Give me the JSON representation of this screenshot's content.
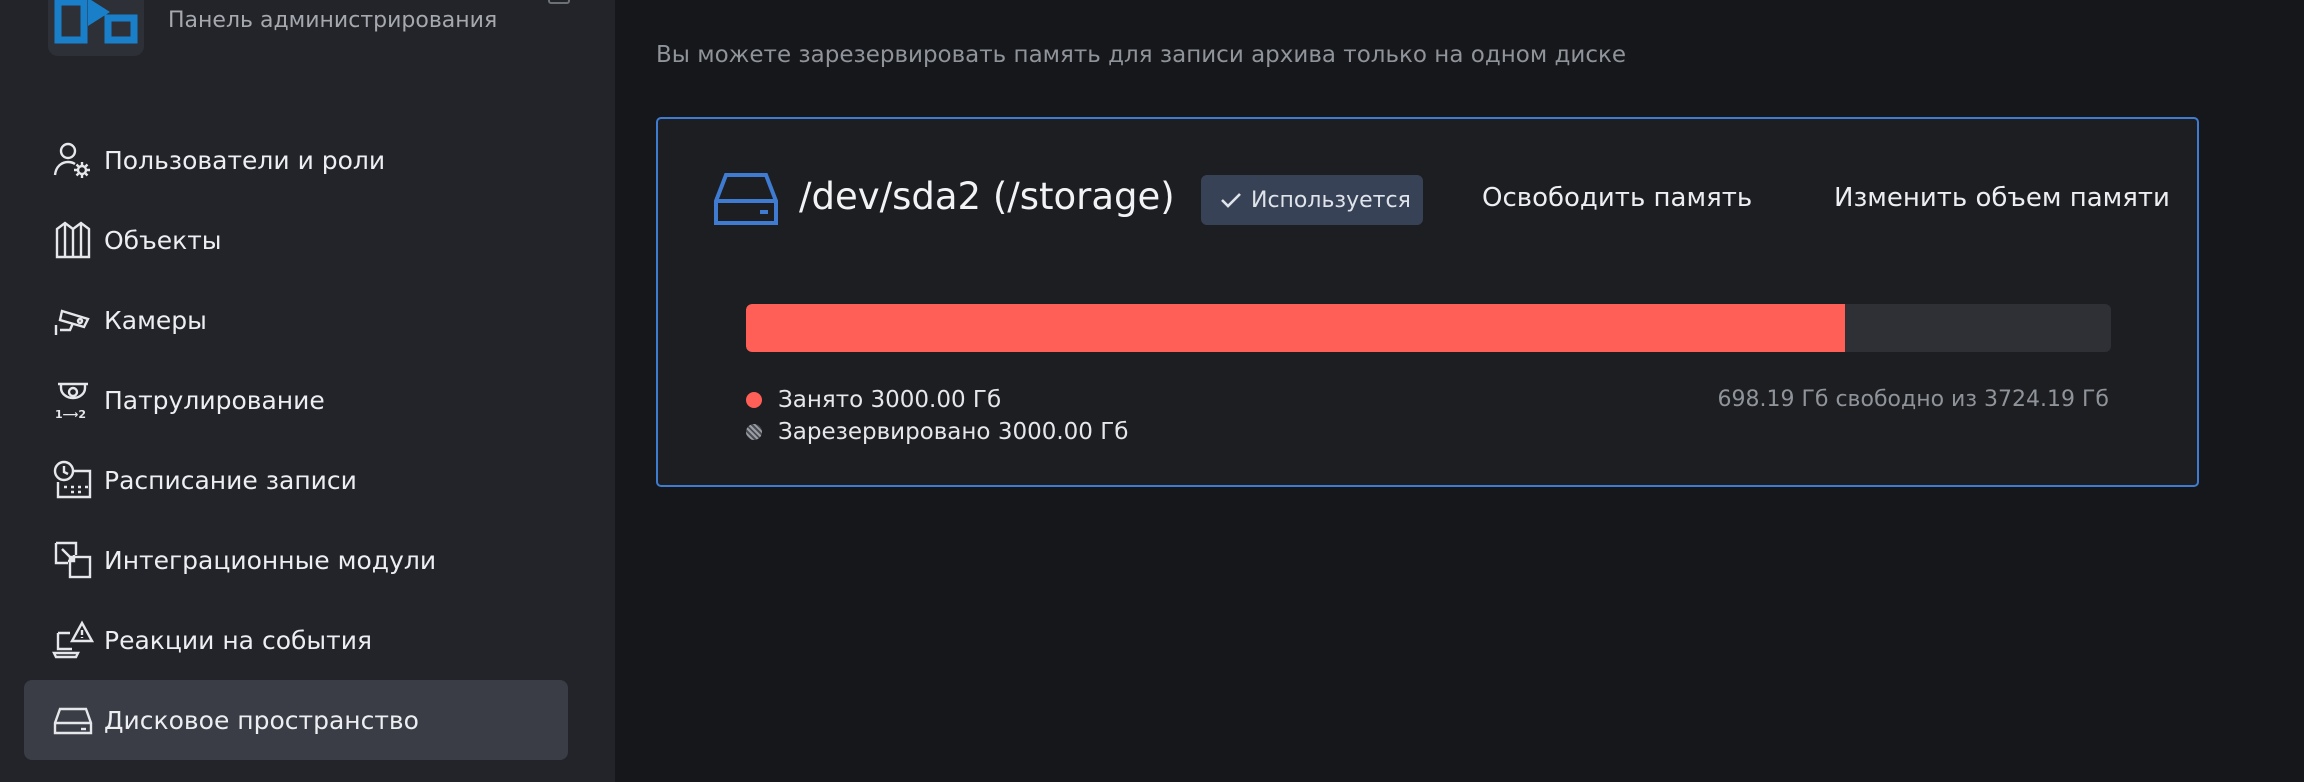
{
  "brand": {
    "subtitle": "Панель администрирования",
    "logo_icon": "video-play-logo-icon",
    "accent": "#1a7fc9"
  },
  "sidebar": {
    "items": [
      {
        "label": "Пользователи и роли",
        "icon": "user-gear-icon",
        "active": false
      },
      {
        "label": "Объекты",
        "icon": "building-icon",
        "active": false
      },
      {
        "label": "Камеры",
        "icon": "security-camera-icon",
        "active": false
      },
      {
        "label": "Патрулирование",
        "icon": "patrol-dome-camera-icon",
        "active": false
      },
      {
        "label": "Расписание записи",
        "icon": "clock-calendar-icon",
        "active": false
      },
      {
        "label": "Интеграционные модули",
        "icon": "integration-module-icon",
        "active": false
      },
      {
        "label": "Реакции на события",
        "icon": "laptop-warning-icon",
        "active": false
      },
      {
        "label": "Дисковое пространство",
        "icon": "hard-drive-icon",
        "active": true
      }
    ]
  },
  "main": {
    "subtitle": "Вы можете зарезервировать память для записи архива только на одном диске",
    "disk": {
      "name": "/dev/sda2 (/storage)",
      "status": "Используется",
      "actions": {
        "free": "Освободить память",
        "resize": "Изменить объем памяти"
      },
      "usage_fraction": 0.8053,
      "legend": {
        "used": "Занято 3000.00 Гб",
        "reserved": "Зарезервировано 3000.00 Гб"
      },
      "free_info": "698.19 Гб свободно из 3724.19 Гб"
    }
  },
  "colors": {
    "used": "#ff5f57",
    "card_border": "#3f7bd0",
    "badge_bg": "#384257",
    "active_item_bg": "#3a3d45"
  }
}
